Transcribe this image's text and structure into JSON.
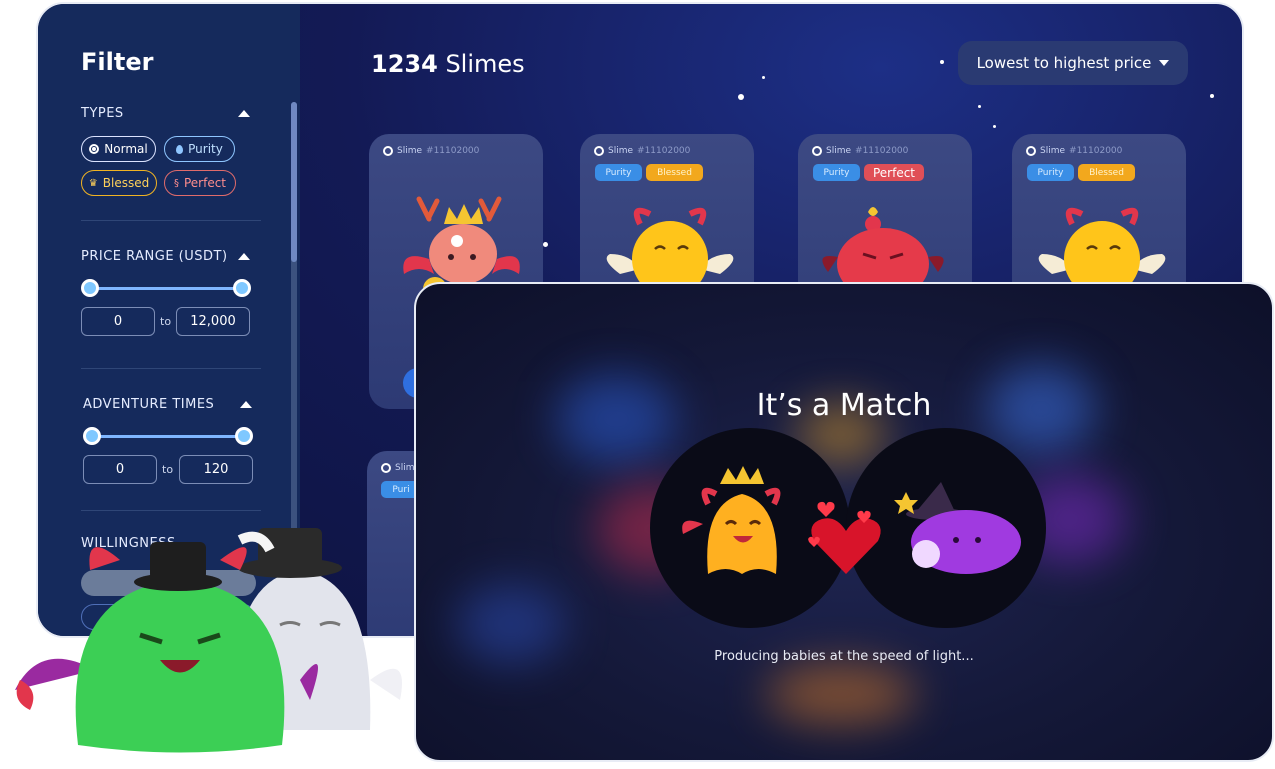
{
  "filter": {
    "title": "Filter",
    "types_label": "TYPES",
    "types": [
      {
        "label": "Normal",
        "icon": "target-icon"
      },
      {
        "label": "Purity",
        "icon": "droplet-icon"
      },
      {
        "label": "Blessed",
        "icon": "crown-icon"
      },
      {
        "label": "Perfect",
        "icon": "helix-icon"
      }
    ],
    "price_label": "PRICE RANGE (USDT)",
    "price_min": "0",
    "price_max": "12,000",
    "adventure_label": "ADVENTURE TIMES",
    "adventure_min": "0",
    "adventure_max": "120",
    "range_to": "to",
    "willingness_label": "WILLINGNESS"
  },
  "listing": {
    "count": "1234",
    "noun": "Slimes",
    "sort_label": "Lowest to highest price"
  },
  "cards": [
    {
      "name": "Slime",
      "id": "#11102000",
      "tags": []
    },
    {
      "name": "Slime",
      "id": "#11102000",
      "tags": [
        "Purity",
        "Blessed"
      ]
    },
    {
      "name": "Slime",
      "id": "#11102000",
      "tags": [
        "Purity",
        "Perfect"
      ]
    },
    {
      "name": "Slime",
      "id": "#11102000",
      "tags": [
        "Purity",
        "Blessed"
      ]
    },
    {
      "name": "Slim",
      "id": "",
      "tags": [
        "Puri"
      ]
    }
  ],
  "match": {
    "title": "It’s a Match",
    "subtitle": "Producing babies at the speed of light..."
  },
  "colors": {
    "background": "#131a55",
    "panel": "#152a5c",
    "card": "#3c4983",
    "purity": "#3a8ee6",
    "blessed": "#f2a81d",
    "perfect": "#e04f57"
  }
}
